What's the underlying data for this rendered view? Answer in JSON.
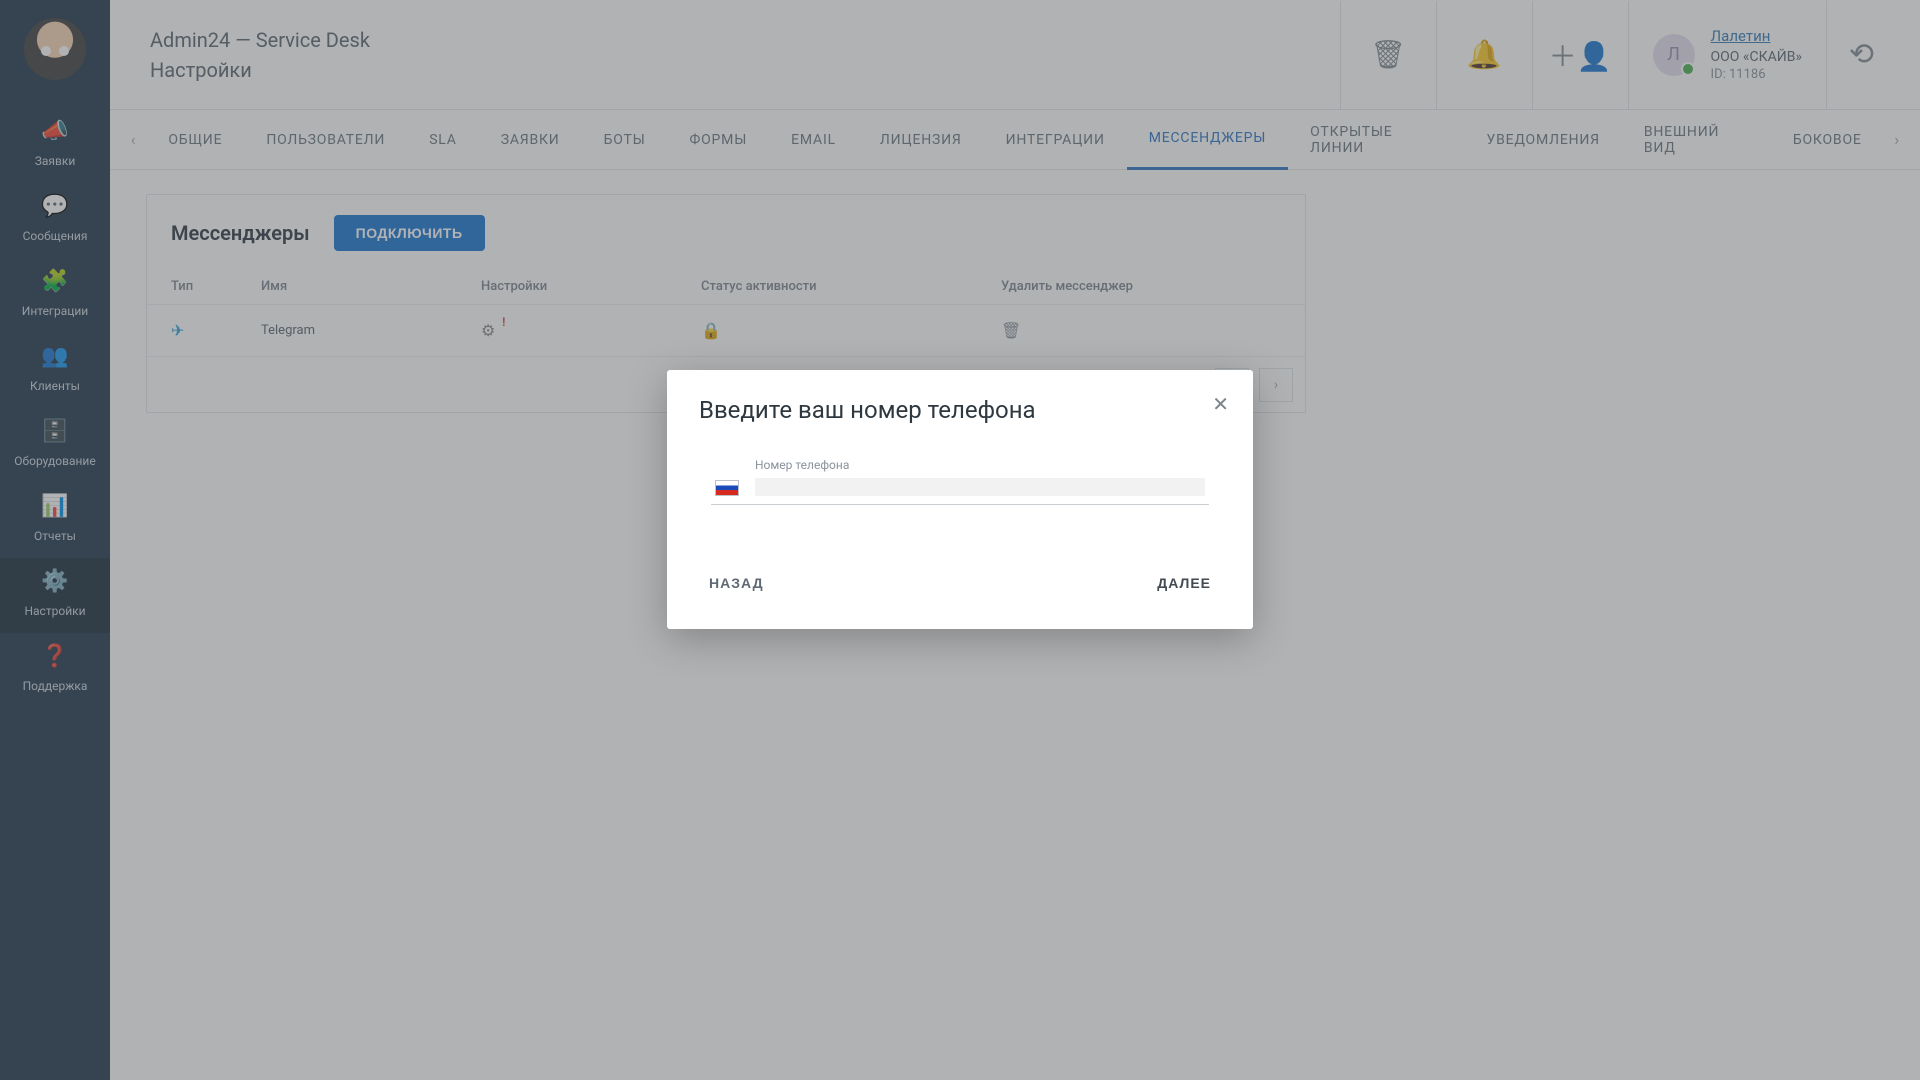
{
  "header": {
    "title": "Admin24 — Service Desk",
    "subtitle": "Настройки"
  },
  "user": {
    "initial": "Л",
    "name": "Лалетин",
    "company": "ООО «СКАЙВ»",
    "id_label": "ID: 11186"
  },
  "sidebar": {
    "items": [
      {
        "label": "Заявки",
        "icon": "📣"
      },
      {
        "label": "Сообщения",
        "icon": "💬"
      },
      {
        "label": "Интеграции",
        "icon": "🧩"
      },
      {
        "label": "Клиенты",
        "icon": "👥"
      },
      {
        "label": "Оборудование",
        "icon": "🗄️"
      },
      {
        "label": "Отчеты",
        "icon": "📊"
      },
      {
        "label": "Настройки",
        "icon": "⚙️"
      },
      {
        "label": "Поддержка",
        "icon": "❓"
      }
    ]
  },
  "tabs": [
    "ОБЩИЕ",
    "ПОЛЬЗОВАТЕЛИ",
    "SLA",
    "ЗАЯВКИ",
    "БОТЫ",
    "ФОРМЫ",
    "EMAIL",
    "ЛИЦЕНЗИЯ",
    "ИНТЕГРАЦИИ",
    "МЕССЕНДЖЕРЫ",
    "ОТКРЫТЫЕ ЛИНИИ",
    "УВЕДОМЛЕНИЯ",
    "ВНЕШНИЙ ВИД",
    "БОКОВОЕ"
  ],
  "active_tab_index": 9,
  "panel": {
    "title": "Мессенджеры",
    "connect_btn": "ПОДКЛЮЧИТЬ",
    "columns": {
      "type": "Тип",
      "name": "Имя",
      "settings": "Настройки",
      "status": "Статус активности",
      "delete": "Удалить мессенджер"
    },
    "rows": [
      {
        "name": "Telegram"
      }
    ]
  },
  "modal": {
    "title": "Введите ваш номер телефона",
    "phone_label": "Номер телефона",
    "phone_value": "",
    "back": "НАЗАД",
    "next": "ДАЛЕЕ"
  }
}
